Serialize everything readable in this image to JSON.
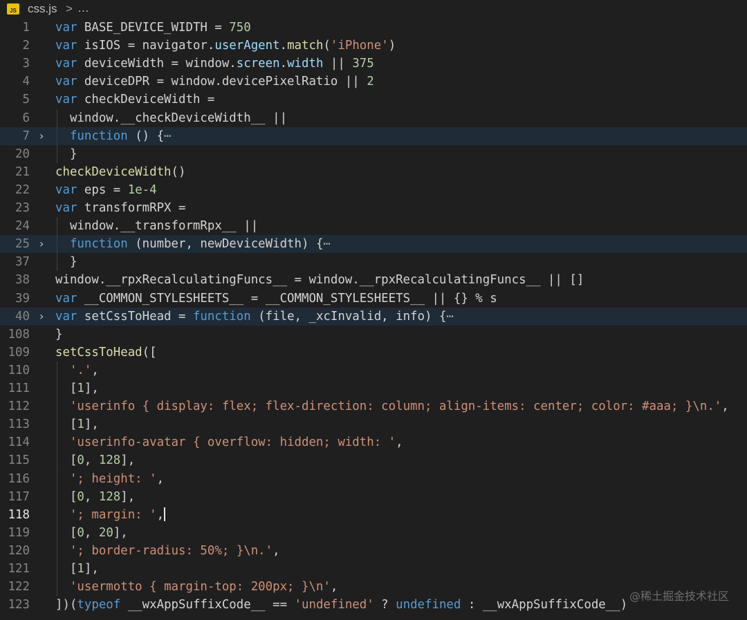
{
  "breadcrumb": {
    "file_badge": "JS",
    "file_name": "css.js",
    "separator": ">",
    "ellipsis": "…"
  },
  "colors": {
    "background": "#1f1f1f",
    "keyword": "#569cd6",
    "property": "#9cdcfe",
    "string": "#ce9178",
    "number": "#b5cea8",
    "function": "#dcdcaa",
    "text": "#d4d4d4",
    "line_highlight": "#1f2b36"
  },
  "watermark": "@稀土掘金技术社区",
  "lines": [
    {
      "num": "1",
      "tokens": [
        [
          "k",
          "var"
        ],
        [
          "t",
          " BASE_DEVICE_WIDTH = "
        ],
        [
          "n",
          "750"
        ]
      ]
    },
    {
      "num": "2",
      "tokens": [
        [
          "k",
          "var"
        ],
        [
          "t",
          " isIOS = navigator."
        ],
        [
          "p",
          "userAgent"
        ],
        [
          "t",
          "."
        ],
        [
          "f",
          "match"
        ],
        [
          "t",
          "("
        ],
        [
          "s",
          "'iPhone'"
        ],
        [
          "t",
          ")"
        ]
      ]
    },
    {
      "num": "3",
      "tokens": [
        [
          "k",
          "var"
        ],
        [
          "t",
          " deviceWidth = window."
        ],
        [
          "p",
          "screen"
        ],
        [
          "t",
          "."
        ],
        [
          "p",
          "width"
        ],
        [
          "t",
          " || "
        ],
        [
          "n",
          "375"
        ]
      ]
    },
    {
      "num": "4",
      "tokens": [
        [
          "k",
          "var"
        ],
        [
          "t",
          " deviceDPR = window.devicePixelRatio || "
        ],
        [
          "n",
          "2"
        ]
      ]
    },
    {
      "num": "5",
      "tokens": [
        [
          "k",
          "var"
        ],
        [
          "t",
          " checkDeviceWidth ="
        ]
      ]
    },
    {
      "num": "6",
      "tokens": [
        [
          "t",
          "  window.__checkDeviceWidth__ ||"
        ]
      ]
    },
    {
      "num": "7",
      "fold": "›",
      "highlight": true,
      "tokens": [
        [
          "t",
          "  "
        ],
        [
          "k",
          "function"
        ],
        [
          "t",
          " () {"
        ],
        [
          "e",
          "⋯"
        ]
      ]
    },
    {
      "num": "20",
      "tokens": [
        [
          "t",
          "  }"
        ]
      ]
    },
    {
      "num": "21",
      "tokens": [
        [
          "f",
          "checkDeviceWidth"
        ],
        [
          "t",
          "()"
        ]
      ]
    },
    {
      "num": "22",
      "tokens": [
        [
          "k",
          "var"
        ],
        [
          "t",
          " eps = "
        ],
        [
          "n",
          "1e-4"
        ]
      ]
    },
    {
      "num": "23",
      "tokens": [
        [
          "k",
          "var"
        ],
        [
          "t",
          " transformRPX ="
        ]
      ]
    },
    {
      "num": "24",
      "tokens": [
        [
          "t",
          "  window.__transformRpx__ ||"
        ]
      ]
    },
    {
      "num": "25",
      "fold": "›",
      "highlight": true,
      "tokens": [
        [
          "t",
          "  "
        ],
        [
          "k",
          "function"
        ],
        [
          "t",
          " (number, newDeviceWidth) {"
        ],
        [
          "e",
          "⋯"
        ]
      ]
    },
    {
      "num": "37",
      "tokens": [
        [
          "t",
          "  }"
        ]
      ]
    },
    {
      "num": "38",
      "tokens": [
        [
          "t",
          "window.__rpxRecalculatingFuncs__ = window.__rpxRecalculatingFuncs__ || []"
        ]
      ]
    },
    {
      "num": "39",
      "tokens": [
        [
          "k",
          "var"
        ],
        [
          "t",
          " __COMMON_STYLESHEETS__ = __COMMON_STYLESHEETS__ || {} % s"
        ]
      ]
    },
    {
      "num": "40",
      "fold": "›",
      "highlight": true,
      "tokens": [
        [
          "k",
          "var"
        ],
        [
          "t",
          " setCssToHead = "
        ],
        [
          "k",
          "function"
        ],
        [
          "t",
          " (file, _xcInvalid, info) {"
        ],
        [
          "e",
          "⋯"
        ]
      ]
    },
    {
      "num": "108",
      "tokens": [
        [
          "t",
          "}"
        ]
      ]
    },
    {
      "num": "109",
      "tokens": [
        [
          "f",
          "setCssToHead"
        ],
        [
          "t",
          "(["
        ]
      ]
    },
    {
      "num": "110",
      "tokens": [
        [
          "t",
          "  "
        ],
        [
          "s",
          "'.'"
        ],
        [
          "t",
          ","
        ]
      ]
    },
    {
      "num": "111",
      "tokens": [
        [
          "t",
          "  ["
        ],
        [
          "n",
          "1"
        ],
        [
          "t",
          "],"
        ]
      ]
    },
    {
      "num": "112",
      "tokens": [
        [
          "t",
          "  "
        ],
        [
          "s",
          "'userinfo { display: flex; flex-direction: column; align-items: center; color: #aaa; }\\n.'"
        ],
        [
          "t",
          ","
        ]
      ]
    },
    {
      "num": "113",
      "tokens": [
        [
          "t",
          "  ["
        ],
        [
          "n",
          "1"
        ],
        [
          "t",
          "],"
        ]
      ]
    },
    {
      "num": "114",
      "tokens": [
        [
          "t",
          "  "
        ],
        [
          "s",
          "'userinfo-avatar { overflow: hidden; width: '"
        ],
        [
          "t",
          ","
        ]
      ]
    },
    {
      "num": "115",
      "tokens": [
        [
          "t",
          "  ["
        ],
        [
          "n",
          "0"
        ],
        [
          "t",
          ", "
        ],
        [
          "n",
          "128"
        ],
        [
          "t",
          "],"
        ]
      ]
    },
    {
      "num": "116",
      "tokens": [
        [
          "t",
          "  "
        ],
        [
          "s",
          "'; height: '"
        ],
        [
          "t",
          ","
        ]
      ]
    },
    {
      "num": "117",
      "tokens": [
        [
          "t",
          "  ["
        ],
        [
          "n",
          "0"
        ],
        [
          "t",
          ", "
        ],
        [
          "n",
          "128"
        ],
        [
          "t",
          "],"
        ]
      ]
    },
    {
      "num": "118",
      "active": true,
      "tokens": [
        [
          "t",
          "  "
        ],
        [
          "s",
          "'; margin: '"
        ],
        [
          "t",
          ","
        ]
      ]
    },
    {
      "num": "119",
      "tokens": [
        [
          "t",
          "  ["
        ],
        [
          "n",
          "0"
        ],
        [
          "t",
          ", "
        ],
        [
          "n",
          "20"
        ],
        [
          "t",
          "],"
        ]
      ]
    },
    {
      "num": "120",
      "tokens": [
        [
          "t",
          "  "
        ],
        [
          "s",
          "'; border-radius: 50%; }\\n.'"
        ],
        [
          "t",
          ","
        ]
      ]
    },
    {
      "num": "121",
      "tokens": [
        [
          "t",
          "  ["
        ],
        [
          "n",
          "1"
        ],
        [
          "t",
          "],"
        ]
      ]
    },
    {
      "num": "122",
      "tokens": [
        [
          "t",
          "  "
        ],
        [
          "s",
          "'usermotto { margin-top: 200px; }\\n'"
        ],
        [
          "t",
          ","
        ]
      ]
    },
    {
      "num": "123",
      "tokens": [
        [
          "t",
          "])("
        ],
        [
          "k",
          "typeof"
        ],
        [
          "t",
          " __wxAppSuffixCode__ == "
        ],
        [
          "s",
          "'undefined'"
        ],
        [
          "t",
          " ? "
        ],
        [
          "k",
          "undefined"
        ],
        [
          "t",
          " : __wxAppSuffixCode__)"
        ]
      ]
    }
  ]
}
